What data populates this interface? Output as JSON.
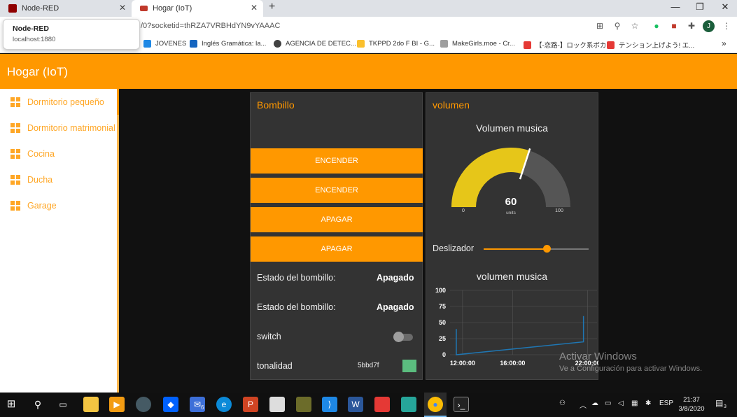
{
  "browser": {
    "tabs": [
      {
        "title": "Node-RED",
        "favicon_color": "#8f0000"
      },
      {
        "title": "Hogar (IoT)",
        "favicon_color": "#c0392b"
      }
    ],
    "tooltip": {
      "title": "Node-RED",
      "url": "localhost:1880"
    },
    "url": "/0?socketid=thRZA7VRBHdYN9vYAAAC",
    "avatar_letter": "J",
    "bookmarks": [
      {
        "label": "JOVENES",
        "color": "#1e88e5"
      },
      {
        "label": "Inglés Gramática: la...",
        "color": "#1565c0"
      },
      {
        "label": "AGENCIA DE DETEC...",
        "color": "#424242"
      },
      {
        "label": "TKPPD 2do F BI - G...",
        "color": "#fbc02d"
      },
      {
        "label": "MakeGirls.moe - Cr...",
        "color": "#9e9e9e"
      },
      {
        "label": "【-恋路-】ロック系ボカ...",
        "color": "#e53935"
      },
      {
        "label": "テンション上げよう! エ...",
        "color": "#e53935"
      }
    ]
  },
  "app": {
    "title": "Hogar (IoT)",
    "nav": [
      {
        "label": "Dormitorio pequeño"
      },
      {
        "label": "Dormitorio matrimonial"
      },
      {
        "label": "Cocina"
      },
      {
        "label": "Ducha"
      },
      {
        "label": "Garage"
      }
    ]
  },
  "bombillo": {
    "title": "Bombillo",
    "buttons": [
      "ENCENDER",
      "ENCENDER",
      "APAGAR",
      "APAGAR"
    ],
    "status_rows": [
      {
        "label": "Estado del bombillo:",
        "value": "Apagado"
      },
      {
        "label": "Estado del bombillo:",
        "value": "Apagado"
      }
    ],
    "switch_label": "switch",
    "switch_on": false,
    "color_label": "tonalidad",
    "color_hex": "5bbd7f",
    "color_value": "#5bbd7f"
  },
  "volumen": {
    "title": "volumen",
    "gauge": {
      "title": "Volumen musica",
      "value": 60,
      "display": "60",
      "units": "units",
      "min": 0,
      "max": 100,
      "min_label": "0",
      "max_label": "100",
      "color": "#e6c619"
    },
    "slider": {
      "label": "Deslizador",
      "value": 60,
      "max": 100
    },
    "chart_title": "volumen musica"
  },
  "chart_data": {
    "type": "line",
    "title": "volumen musica",
    "xlabel": "",
    "ylabel": "",
    "ylim": [
      0,
      100
    ],
    "y_ticks": [
      "0",
      "25",
      "50",
      "75",
      "100"
    ],
    "x_ticks": [
      "12:00:00",
      "16:00:00",
      "22:00:00"
    ],
    "series": [
      {
        "color": "#1f77b4",
        "points": [
          [
            "11:30",
            40
          ],
          [
            "11:30",
            0
          ],
          [
            "21:40",
            20
          ],
          [
            "21:40",
            60
          ]
        ]
      }
    ]
  },
  "watermark": {
    "line1": "Activar Windows",
    "line2": "Ve a Configuración para activar Windows."
  },
  "taskbar": {
    "lang": "ESP",
    "time": "21:37",
    "date": "3/8/2020",
    "notifications": "3",
    "mail_badge": "6"
  }
}
